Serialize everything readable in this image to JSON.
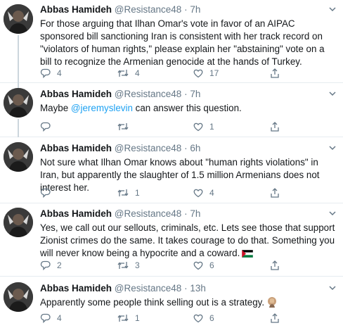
{
  "tweets": [
    {
      "author_name": "Abbas Hamideh",
      "handle": "@Resistance48",
      "separator": "·",
      "time": "7h",
      "text_before": "For those arguing that Ilhan Omar's vote in favor of an AIPAC sponsored bill sanctioning Iran is consistent with her track record on \"violators of human rights,\" please explain her \"abstaining\" vote on a bill to recognize the Armenian genocide at the hands of Turkey.",
      "mention": "",
      "text_after": "",
      "replies": "4",
      "retweets": "4",
      "likes": "17"
    },
    {
      "author_name": "Abbas Hamideh",
      "handle": "@Resistance48",
      "separator": "·",
      "time": "7h",
      "text_before": "Maybe ",
      "mention": "@jeremyslevin",
      "text_after": " can answer this question.",
      "replies": "",
      "retweets": "",
      "likes": "1"
    },
    {
      "author_name": "Abbas Hamideh",
      "handle": "@Resistance48",
      "separator": "·",
      "time": "6h",
      "text_before": "Not sure what Ilhan Omar knows about \"human rights violations\" in Iran, but apparently the slaughter of 1.5 million Armenians does not interest her.",
      "mention": "",
      "text_after": "",
      "replies": "",
      "retweets": "1",
      "likes": "4"
    },
    {
      "author_name": "Abbas Hamideh",
      "handle": "@Resistance48",
      "separator": "·",
      "time": "7h",
      "text_before": "Yes, we call out our sellouts, criminals, etc. Lets see those that support Zionist crimes do the same. It takes courage to do that. Something you will never know being a hypocrite and a coward.",
      "mention": "",
      "text_after": "",
      "replies": "2",
      "retweets": "3",
      "likes": "6"
    },
    {
      "author_name": "Abbas Hamideh",
      "handle": "@Resistance48",
      "separator": "·",
      "time": "13h",
      "text_before": "Apparently some people think selling out is a strategy.",
      "mention": "",
      "text_after": "",
      "replies": "4",
      "retweets": "1",
      "likes": "6"
    }
  ],
  "icons": {
    "reply": "reply-icon",
    "retweet": "retweet-icon",
    "like": "heart-icon",
    "share": "share-icon",
    "more": "chevron-down-icon",
    "flag": "palestine-flag-icon",
    "emoji": "facepalm-emoji-icon"
  },
  "colors": {
    "text": "#14171a",
    "secondary": "#657786",
    "link": "#1da1f2",
    "divider": "#e6ecf0",
    "thread_line": "#ccd6dd"
  }
}
